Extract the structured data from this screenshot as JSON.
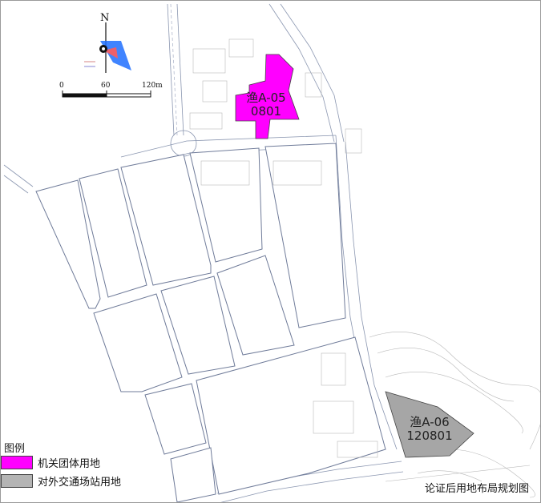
{
  "map": {
    "title": "论证后用地布局规划图",
    "north_label": "N",
    "scale_labels": [
      "0",
      "60",
      "120m"
    ]
  },
  "parcels": [
    {
      "id": "渔A-05",
      "code": "0801",
      "fill": "#ff00ff",
      "category": "机关团体用地"
    },
    {
      "id": "渔A-06",
      "code": "120801",
      "fill": "#a6a6a6",
      "category": "对外交通场站用地"
    }
  ],
  "legend": {
    "title": "图例",
    "items": [
      {
        "label": "机关团体用地",
        "color": "#ff00ff"
      },
      {
        "label": "对外交通场站用地",
        "color": "#b4b4b4"
      }
    ]
  },
  "colors": {
    "road_line": "#8a96b0",
    "block_line": "#6f7b99",
    "survey_detail": "#b8b8b8"
  }
}
